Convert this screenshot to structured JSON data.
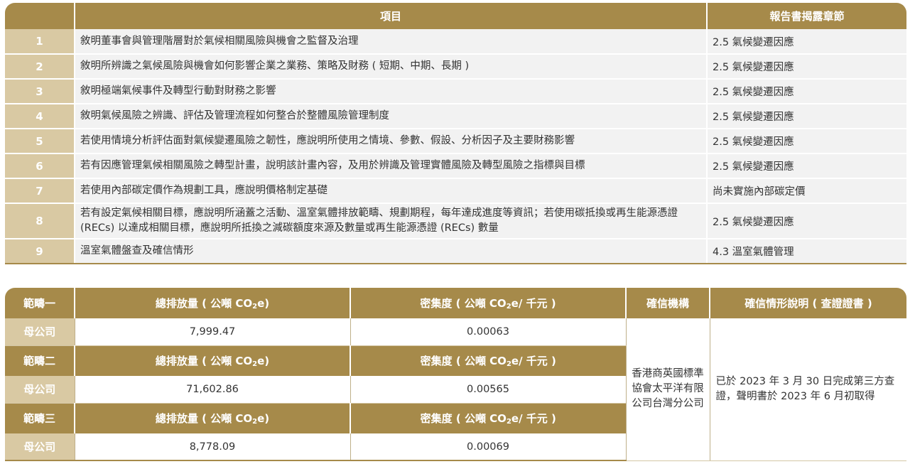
{
  "disclosure_table": {
    "headers": {
      "item": "項目",
      "chapter": "報告書揭露章節"
    },
    "rows": [
      {
        "num": "1",
        "item": "敘明董事會與管理階層對於氣候相關風險與機會之監督及治理",
        "chapter": "2.5 氣候變遷因應"
      },
      {
        "num": "2",
        "item": "敘明所辨識之氣候風險與機會如何影響企業之業務、策略及財務 ( 短期、中期、長期 )",
        "chapter": "2.5 氣候變遷因應"
      },
      {
        "num": "3",
        "item": "敘明極端氣候事件及轉型行動對財務之影響",
        "chapter": "2.5 氣候變遷因應"
      },
      {
        "num": "4",
        "item": "敘明氣候風險之辨識、評估及管理流程如何整合於整體風險管理制度",
        "chapter": "2.5 氣候變遷因應"
      },
      {
        "num": "5",
        "item": "若使用情境分析評估面對氣候變遷風險之韌性，應說明所使用之情境、參數、假設、分析因子及主要財務影響",
        "chapter": "2.5 氣候變遷因應"
      },
      {
        "num": "6",
        "item": "若有因應管理氣候相關風險之轉型計畫，說明該計畫內容，及用於辨識及管理實體風險及轉型風險之指標與目標",
        "chapter": "2.5 氣候變遷因應"
      },
      {
        "num": "7",
        "item": "若使用內部碳定價作為規劃工具，應說明價格制定基礎",
        "chapter": "尚未實施內部碳定價"
      },
      {
        "num": "8",
        "item": "若有設定氣候相關目標，應說明所涵蓋之活動、溫室氣體排放範疇、規劃期程，每年達成進度等資訊；若使用碳抵換或再生能源憑證 (RECs) 以達成相關目標，應說明所抵換之減碳額度來源及數量或再生能源憑證 (RECs) 數量",
        "chapter": "2.5 氣候變遷因應"
      },
      {
        "num": "9",
        "item": "溫室氣體盤查及確信情形",
        "chapter": "4.3 溫室氣體管理"
      }
    ]
  },
  "emissions_table": {
    "header_total_pre": "總排放量 ( 公噸 CO",
    "header_total_sub": "2",
    "header_total_post": "e)",
    "header_intensity_pre": "密集度 ( 公噸 CO",
    "header_intensity_sub": "2",
    "header_intensity_post": "e/ 千元 )",
    "header_verifier": "確信機構",
    "header_description": "確信情形說明 ( 查證證書 )",
    "scopes": [
      {
        "scope": "範疇一",
        "entity": "母公司",
        "total": "7,999.47",
        "intensity": "0.00063"
      },
      {
        "scope": "範疇二",
        "entity": "母公司",
        "total": "71,602.86",
        "intensity": "0.00565"
      },
      {
        "scope": "範疇三",
        "entity": "母公司",
        "total": "8,778.09",
        "intensity": "0.00069"
      }
    ],
    "verifier": "香港商英國標準協會太平洋有限公司台灣分公司",
    "description": "已於 2023 年 3 月 30 日完成第三方查證，聲明書於 2023 年 6 月初取得"
  }
}
